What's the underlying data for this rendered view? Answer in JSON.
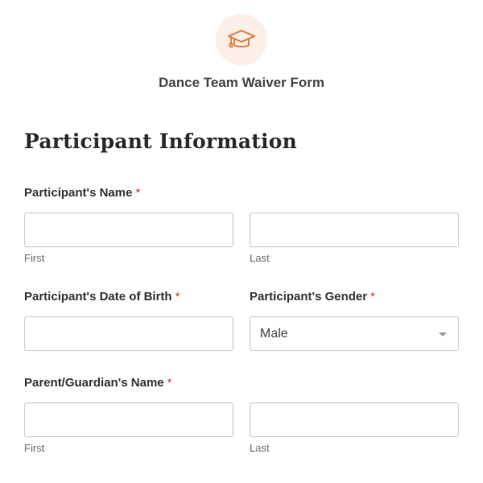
{
  "header": {
    "logo_icon": "graduation-cap-icon",
    "logo_color": "#e27730",
    "logo_bg": "#fcefe7",
    "title": "Dance Team Waiver Form"
  },
  "section": {
    "heading": "Participant Information"
  },
  "required_marker": "*",
  "required_color": "#d63637",
  "fields": {
    "participant_name": {
      "label": "Participant's Name",
      "first": {
        "value": "",
        "sublabel": "First"
      },
      "last": {
        "value": "",
        "sublabel": "Last"
      }
    },
    "date_of_birth": {
      "label": "Participant's Date of Birth",
      "value": ""
    },
    "gender": {
      "label": "Participant's Gender",
      "selected": "Male"
    },
    "parent_name": {
      "label": "Parent/Guardian's Name",
      "first": {
        "value": "",
        "sublabel": "First"
      },
      "last": {
        "value": "",
        "sublabel": "Last"
      }
    }
  }
}
